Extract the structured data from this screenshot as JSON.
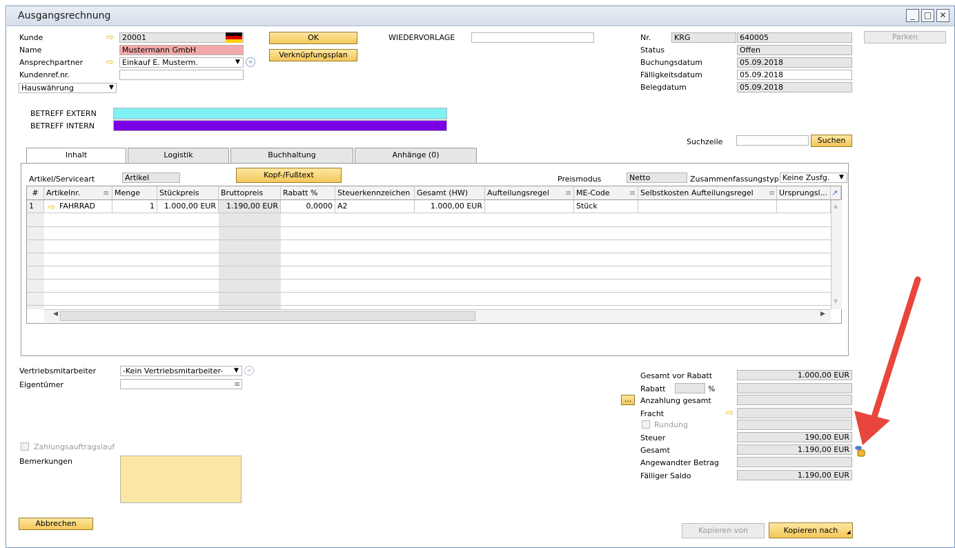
{
  "window": {
    "title": "Ausgangsrechnung",
    "min": "_",
    "max": "□",
    "close": "✕"
  },
  "header": {
    "kunde_label": "Kunde",
    "kunde_value": "20001",
    "name_label": "Name",
    "name_value": "Mustermann GmbH",
    "ansprech_label": "Ansprechpartner",
    "ansprech_value": "Einkauf E. Musterm.",
    "kundenref_label": "Kundenref.nr.",
    "kundenref_value": "",
    "currency_value": "Hauswährung",
    "ok_button": "OK",
    "verknuepfung_button": "Verknüpfungsplan",
    "wiedervorlage_label": "WIEDERVORLAGE",
    "wiedervorlage_value": "",
    "parken_button": "Parken"
  },
  "docinfo": {
    "nr_label": "Nr.",
    "nr_series": "KRG",
    "nr_value": "640005",
    "status_label": "Status",
    "status_value": "Offen",
    "buchung_label": "Buchungsdatum",
    "buchung_value": "05.09.2018",
    "faellig_label": "Fälligkeitsdatum",
    "faellig_value": "05.09.2018",
    "beleg_label": "Belegdatum",
    "beleg_value": "05.09.2018"
  },
  "betreff": {
    "extern_label": "BETREFF EXTERN",
    "extern_color": "#7ff0f4",
    "intern_label": "BETREFF INTERN",
    "intern_color": "#7a00e6"
  },
  "search": {
    "label": "Suchzeile",
    "value": "",
    "button": "Suchen"
  },
  "tabs": [
    {
      "label": "Inhalt"
    },
    {
      "label": "Logistik"
    },
    {
      "label": "Buchhaltung"
    },
    {
      "label": "Anhänge (0)"
    }
  ],
  "content": {
    "artikel_label": "Artikel/Serviceart",
    "artikel_value": "Artikel",
    "kopf_button": "Kopf-/Fußtext",
    "preismodus_label": "Preismodus",
    "preismodus_value": "Netto",
    "zusammen_label": "Zusammenfassungstyp",
    "zusammen_value": "Keine Zusfg."
  },
  "table": {
    "columns": [
      "#",
      "Artikelnr.",
      "Menge",
      "Stückpreis",
      "Bruttopreis",
      "Rabatt %",
      "Steuerkennzeichen",
      "Gesamt (HW)",
      "Aufteilungsregel",
      "ME-Code",
      "Selbstkosten Aufteilungsregel",
      "Ursprungsl..."
    ],
    "rows": [
      [
        "1",
        "FAHRRAD",
        "1",
        "1.000,00 EUR",
        "1.190,00 EUR",
        "0,0000",
        "A2",
        "1.000,00 EUR",
        "",
        "Stück",
        "",
        ""
      ]
    ]
  },
  "footer": {
    "vertrieb_label": "Vertriebsmitarbeiter",
    "vertrieb_value": "-Kein Vertriebsmitarbeiter-",
    "eigentuemer_label": "Eigentümer",
    "eigentuemer_value": "",
    "zahlung_label": "Zahlungsauftragslauf",
    "bemerk_label": "Bemerkungen",
    "bemerk_value": "",
    "abbrechen_button": "Abbrechen",
    "kopieren_von_button": "Kopieren von",
    "kopieren_nach_button": "Kopieren nach"
  },
  "totals": {
    "vor_rabatt_label": "Gesamt vor Rabatt",
    "vor_rabatt_value": "1.000,00 EUR",
    "rabatt_label": "Rabatt",
    "rabatt_pct_symbol": "%",
    "rabatt_value": "",
    "anzahlung_button": "...",
    "anzahlung_label": "Anzahlung gesamt",
    "anzahlung_value": "",
    "fracht_label": "Fracht",
    "fracht_value": "",
    "rundung_label": "Rundung",
    "rundung_value": "",
    "steuer_label": "Steuer",
    "steuer_value": "190,00 EUR",
    "gesamt_label": "Gesamt",
    "gesamt_value": "1.190,00 EUR",
    "angewandt_label": "Angewandter Betrag",
    "angewandt_value": "",
    "saldo_label": "Fälliger Saldo",
    "saldo_value": "1.190,00 EUR"
  },
  "colors": {
    "accent_button": "#f4c75a",
    "annotation_arrow": "#e8453c"
  }
}
